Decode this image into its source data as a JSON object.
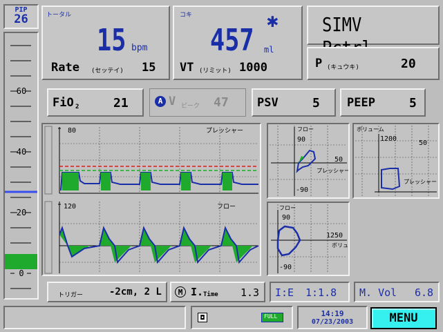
{
  "pip": {
    "label": "PIP",
    "value": "26",
    "ticks": [
      "60",
      "40",
      "20",
      "0"
    ]
  },
  "rate": {
    "title": "トータル",
    "value": "15",
    "unit": "bpm",
    "set_label": "Rate",
    "set_sub": "(セッテイ)",
    "set_value": "15"
  },
  "vt": {
    "title": "コキ",
    "value": "457",
    "unit": "ml",
    "set_label": "VT",
    "set_sub": "(リミット)",
    "set_value": "1000"
  },
  "mode": {
    "label": "SIMV Pctrl"
  },
  "p": {
    "label": "P",
    "sub": "(キュウキ)",
    "value": "20"
  },
  "fio2": {
    "label": "FiO",
    "sub": "2",
    "value": "21"
  },
  "peak": {
    "badge": "A",
    "label": "V",
    "sub": "ピーク",
    "value": "47"
  },
  "psv": {
    "label": "PSV",
    "value": "5"
  },
  "peep": {
    "label": "PEEP",
    "value": "5"
  },
  "waves": {
    "pressure_label": "プレッシャー",
    "pressure_max": "80",
    "flow_label": "フロー",
    "flow_max": "120"
  },
  "loops": {
    "fp": {
      "y_label": "フロー",
      "y_val": "90",
      "y_neg": "-90",
      "x_val": "50",
      "x_label": "プレッシャー"
    },
    "vp": {
      "y_label": "ボリューム",
      "y_val": "1200",
      "x_val": "50",
      "x_label": "プレッシャー"
    },
    "fv": {
      "y_label": "フロー",
      "y_val": "90",
      "y_neg": "-90",
      "x_val": "1250",
      "x_label": "ボリューム"
    }
  },
  "trigger": {
    "label": "トリガー",
    "value": "-2cm, 2 L"
  },
  "itime": {
    "badge": "M",
    "label": "I.",
    "sub": "Time",
    "value": "1.3"
  },
  "ie": {
    "label": "I:E",
    "value": "1:1.8"
  },
  "mvol": {
    "label": "M. Vol",
    "value": "6.8"
  },
  "battery": {
    "label": "FULL"
  },
  "clock": {
    "time": "14:19",
    "date": "07/23/2003"
  },
  "menu": {
    "label": "MENU"
  },
  "colors": {
    "accent": "#1a2ea8",
    "wave_fill": "#1faa2e",
    "alarm": "#d02020",
    "menu_bg": "#36f0f0"
  }
}
